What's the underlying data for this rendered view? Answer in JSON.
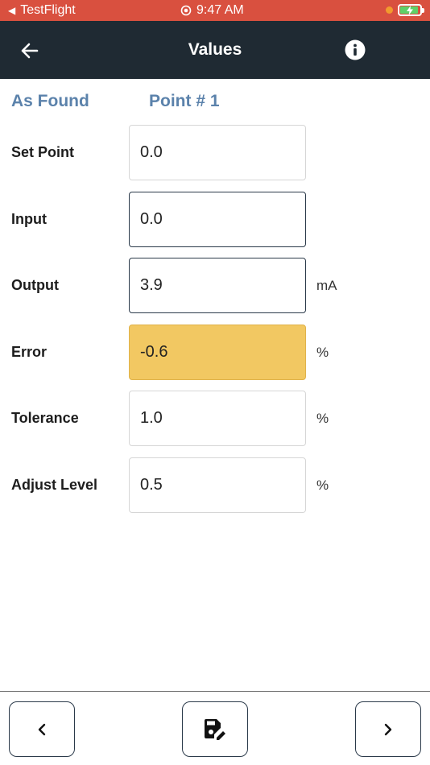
{
  "status_bar": {
    "back_app": "TestFlight",
    "time": "9:47 AM"
  },
  "nav": {
    "title": "Values",
    "back_icon": "arrow-left-icon",
    "info_icon": "info-icon"
  },
  "section": {
    "left": "As Found",
    "right": "Point # 1"
  },
  "rows": [
    {
      "label": "Set Point",
      "value": "0.0",
      "unit": ""
    },
    {
      "label": "Input",
      "value": "0.0",
      "unit": ""
    },
    {
      "label": "Output",
      "value": "3.9",
      "unit": "mA"
    },
    {
      "label": "Error",
      "value": "-0.6",
      "unit": "%"
    },
    {
      "label": "Tolerance",
      "value": "1.0",
      "unit": "%"
    },
    {
      "label": "Adjust Level",
      "value": "0.5",
      "unit": "%"
    }
  ],
  "toolbar": {
    "prev_icon": "chevron-left-icon",
    "save_icon": "save-edit-icon",
    "next_icon": "chevron-right-icon"
  },
  "colors": {
    "status_bar": "#d9503f",
    "nav_bar": "#1f2a33",
    "accent": "#5b82ab",
    "error_highlight": "#f2c862"
  }
}
